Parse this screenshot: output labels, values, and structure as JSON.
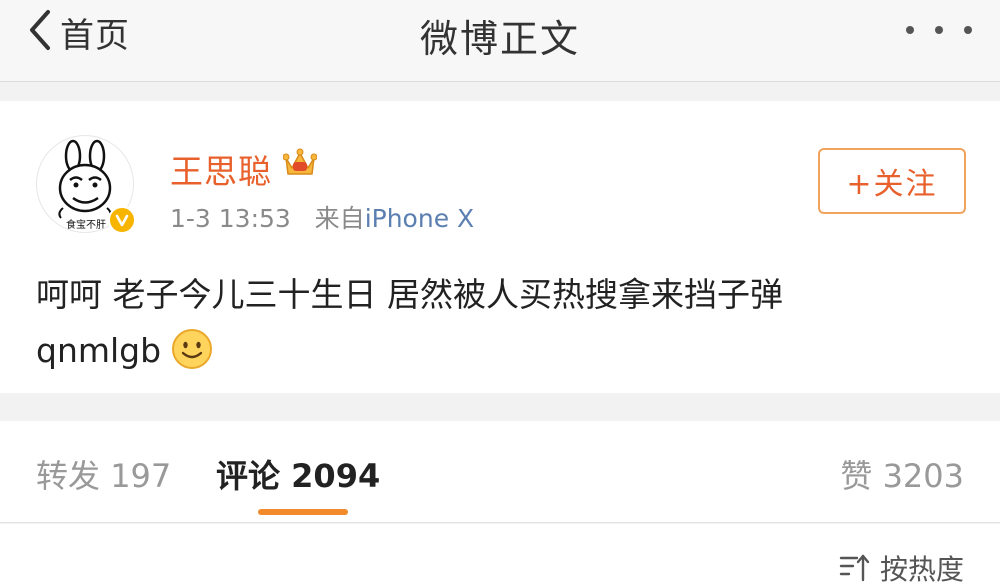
{
  "nav": {
    "back_label": "首页",
    "title": "微博正文",
    "more_icon": "more-dots-icon"
  },
  "post": {
    "user_name": "王思聪",
    "avatar_icon": "meme-avatar",
    "avatar_caption": "食宝不肝",
    "verified_color": "#f7b500",
    "crown_icon": "vip-crown-icon",
    "time": "1-3 13:53",
    "source_prefix": "来自",
    "source": "iPhone X",
    "follow_label": "+关注",
    "text_line1": "呵呵 老子今儿三十生日 居然被人买热搜拿来挡子弹",
    "text_line2": "qnmlgb",
    "emoji_icon": "smile-emoji-icon",
    "name_color": "#e8602c"
  },
  "tabs": {
    "repost_label": "转发",
    "repost_count": "197",
    "comment_label": "评论",
    "comment_count": "2094",
    "like_label": "赞",
    "like_count": "3203",
    "accent_color": "#f08a2a"
  },
  "sort": {
    "label": "按热度",
    "icon": "sort-icon"
  }
}
